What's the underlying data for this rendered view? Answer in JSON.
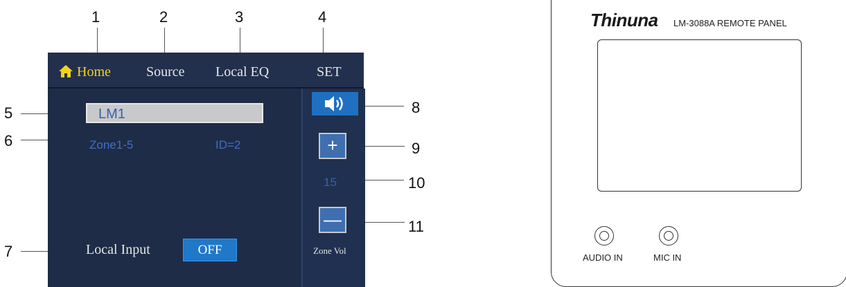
{
  "callouts": [
    "1",
    "2",
    "3",
    "4",
    "5",
    "6",
    "7",
    "8",
    "9",
    "10",
    "11"
  ],
  "screen": {
    "tabs": {
      "home": "Home",
      "source": "Source",
      "local_eq": "Local EQ",
      "set": "SET"
    },
    "name_field": "LM1",
    "zone": "Zone1-5",
    "id": "ID=2",
    "local_input_label": "Local Input",
    "local_input_value": "OFF",
    "plus_label": "+",
    "volume_value": "15",
    "minus_label": "—",
    "zone_vol_label": "Zone Vol"
  },
  "panel": {
    "brand": "Thinuna",
    "model": "LM-3088A REMOTE PANEL",
    "audio_in": "AUDIO IN",
    "mic_in": "MIC IN"
  },
  "colors": {
    "screen_bg": "#1e2c47",
    "accent_yellow": "#f2d21c",
    "accent_blue": "#1f78c8",
    "text_blue": "#3f6fc8"
  },
  "icons": {
    "home": "home-icon",
    "speaker": "speaker-icon"
  }
}
